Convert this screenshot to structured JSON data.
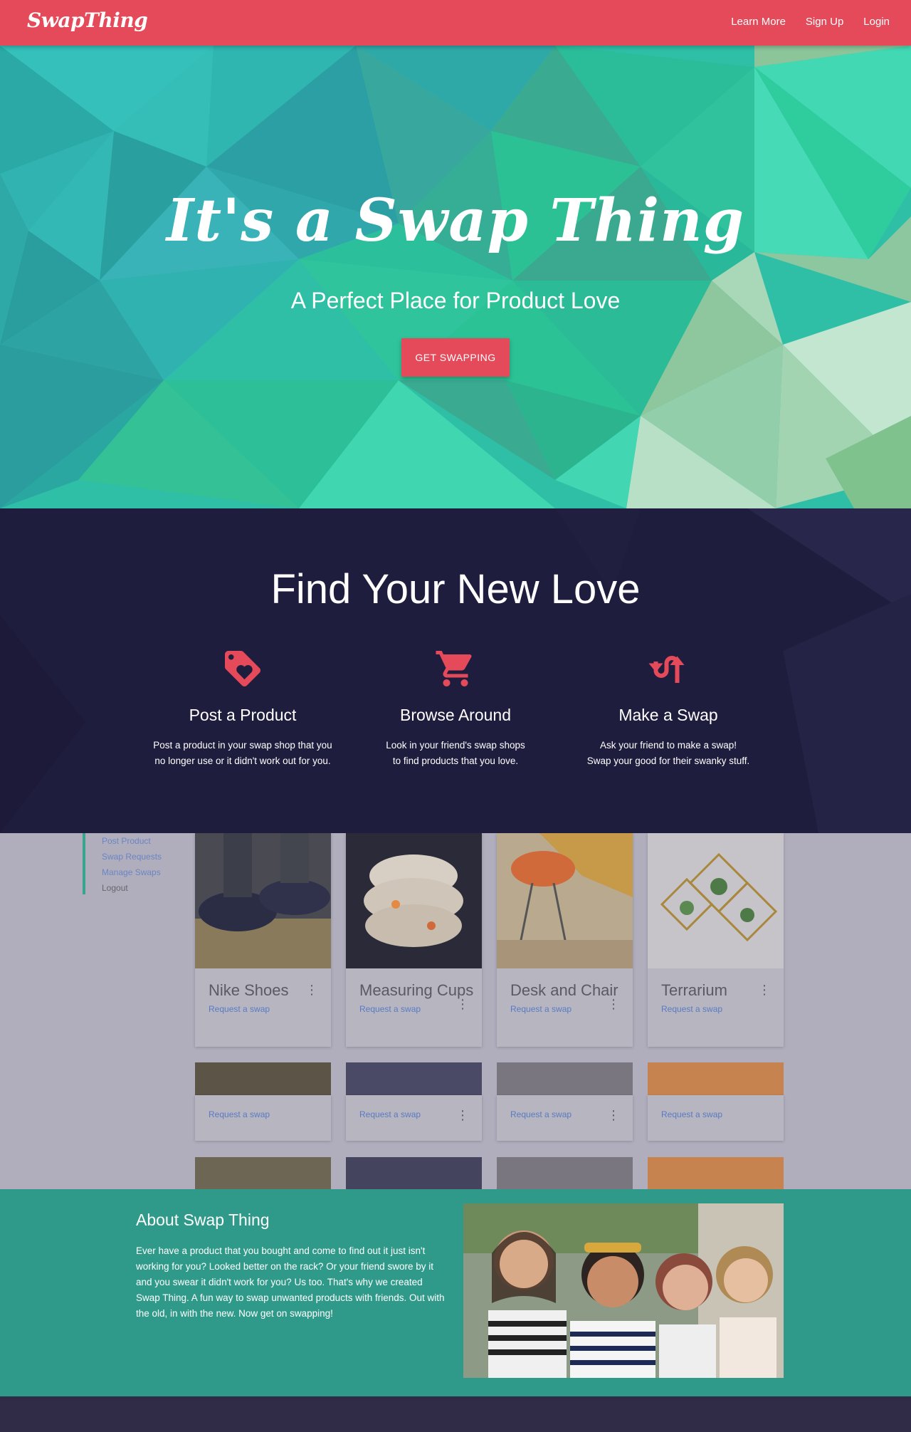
{
  "nav": {
    "logo": "SwapThing",
    "links": [
      "Learn More",
      "Sign Up",
      "Login"
    ]
  },
  "hero": {
    "title": "It's a Swap Thing",
    "subtitle": "A Perfect Place for Product Love",
    "cta": "GET SWAPPING"
  },
  "features": {
    "title": "Find Your New Love",
    "items": [
      {
        "icon": "heart-tag-icon",
        "title": "Post a Product",
        "line1": "Post a product in your swap shop that you",
        "line2": "no longer use or it didn't work out for you."
      },
      {
        "icon": "shopping-cart-icon",
        "title": "Browse Around",
        "line1": "Look in your friend's swap shops",
        "line2": "to find products that you love."
      },
      {
        "icon": "swap-arrows-icon",
        "title": "Make a Swap",
        "line1": "Ask your friend to make a swap!",
        "line2": "Swap your good for their swanky stuff."
      }
    ]
  },
  "preview": {
    "menu": [
      "Post Product",
      "Swap Requests",
      "Manage Swaps",
      "Logout"
    ],
    "cards": [
      {
        "name": "Nike Shoes",
        "action": "Request a swap"
      },
      {
        "name": "Measuring Cups",
        "action": "Request a swap"
      },
      {
        "name": "Desk and Chair",
        "action": "Request a swap"
      },
      {
        "name": "Terrarium",
        "action": "Request a swap"
      }
    ],
    "row2_action": "Request a swap"
  },
  "about": {
    "title": "About Swap Thing",
    "body": "Ever have a product that you bought and come to find out it just isn't working for you? Looked better on the rack? Or your friend swore by it and you swear it didn't work for you? Us too. That's why we created Swap Thing. A fun way to swap unwanted products with friends. Out with the old, in with the new. Now get on swapping!"
  },
  "colors": {
    "brand": "#e44a5a",
    "hero_teal": "#2fbfa7",
    "dark_navy": "#1f1d3d",
    "about_teal": "#309a8a"
  }
}
